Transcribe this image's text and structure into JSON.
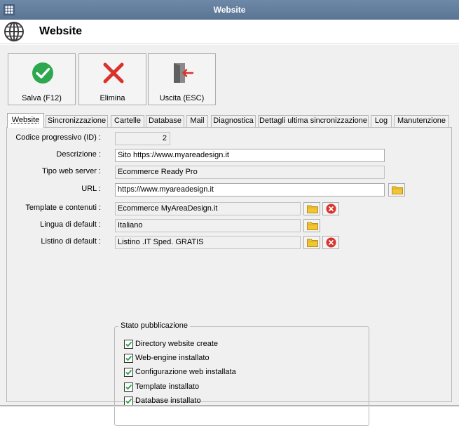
{
  "window": {
    "title": "Website"
  },
  "header": {
    "title": "Website",
    "icon": "globe-icon"
  },
  "toolbar": {
    "save_label": "Salva (F12)",
    "delete_label": "Elimina",
    "exit_label": "Uscita (ESC)"
  },
  "tabs": [
    {
      "label": "Website",
      "active": true
    },
    {
      "label": "Sincronizzazione"
    },
    {
      "label": "Cartelle"
    },
    {
      "label": "Database"
    },
    {
      "label": "Mail"
    },
    {
      "label": "Diagnostica"
    },
    {
      "label": "Dettagli ultima sincronizzazione"
    },
    {
      "label": "Log"
    },
    {
      "label": "Manutenzione"
    }
  ],
  "form": {
    "id_label": "Codice progressivo (ID) :",
    "id_value": "2",
    "descr_label": "Descrizione :",
    "descr_value": "Sito https://www.myareadesign.it",
    "server_label": "Tipo web server :",
    "server_value": "Ecommerce Ready Pro",
    "url_label": "URL :",
    "url_value": "https://www.myareadesign.it",
    "template_label": "Template e contenuti :",
    "template_value": "Ecommerce MyAreaDesign.it",
    "lang_label": "Lingua di default :",
    "lang_value": "Italiano",
    "list_label": "Listino di default :",
    "list_value": "Listino .IT Sped. GRATIS"
  },
  "status_group": {
    "title": "Stato pubblicazione",
    "items": [
      {
        "label": "Directory website create",
        "checked": true
      },
      {
        "label": "Web-engine installato",
        "checked": true
      },
      {
        "label": "Configurazione web installata",
        "checked": true
      },
      {
        "label": "Template installato",
        "checked": true
      },
      {
        "label": "Database installato",
        "checked": true
      }
    ]
  },
  "colors": {
    "titlebar": "#5a7494",
    "check_green": "#2ea84f",
    "delete_red": "#d9322b",
    "folder_yellow": "#f3c532"
  }
}
